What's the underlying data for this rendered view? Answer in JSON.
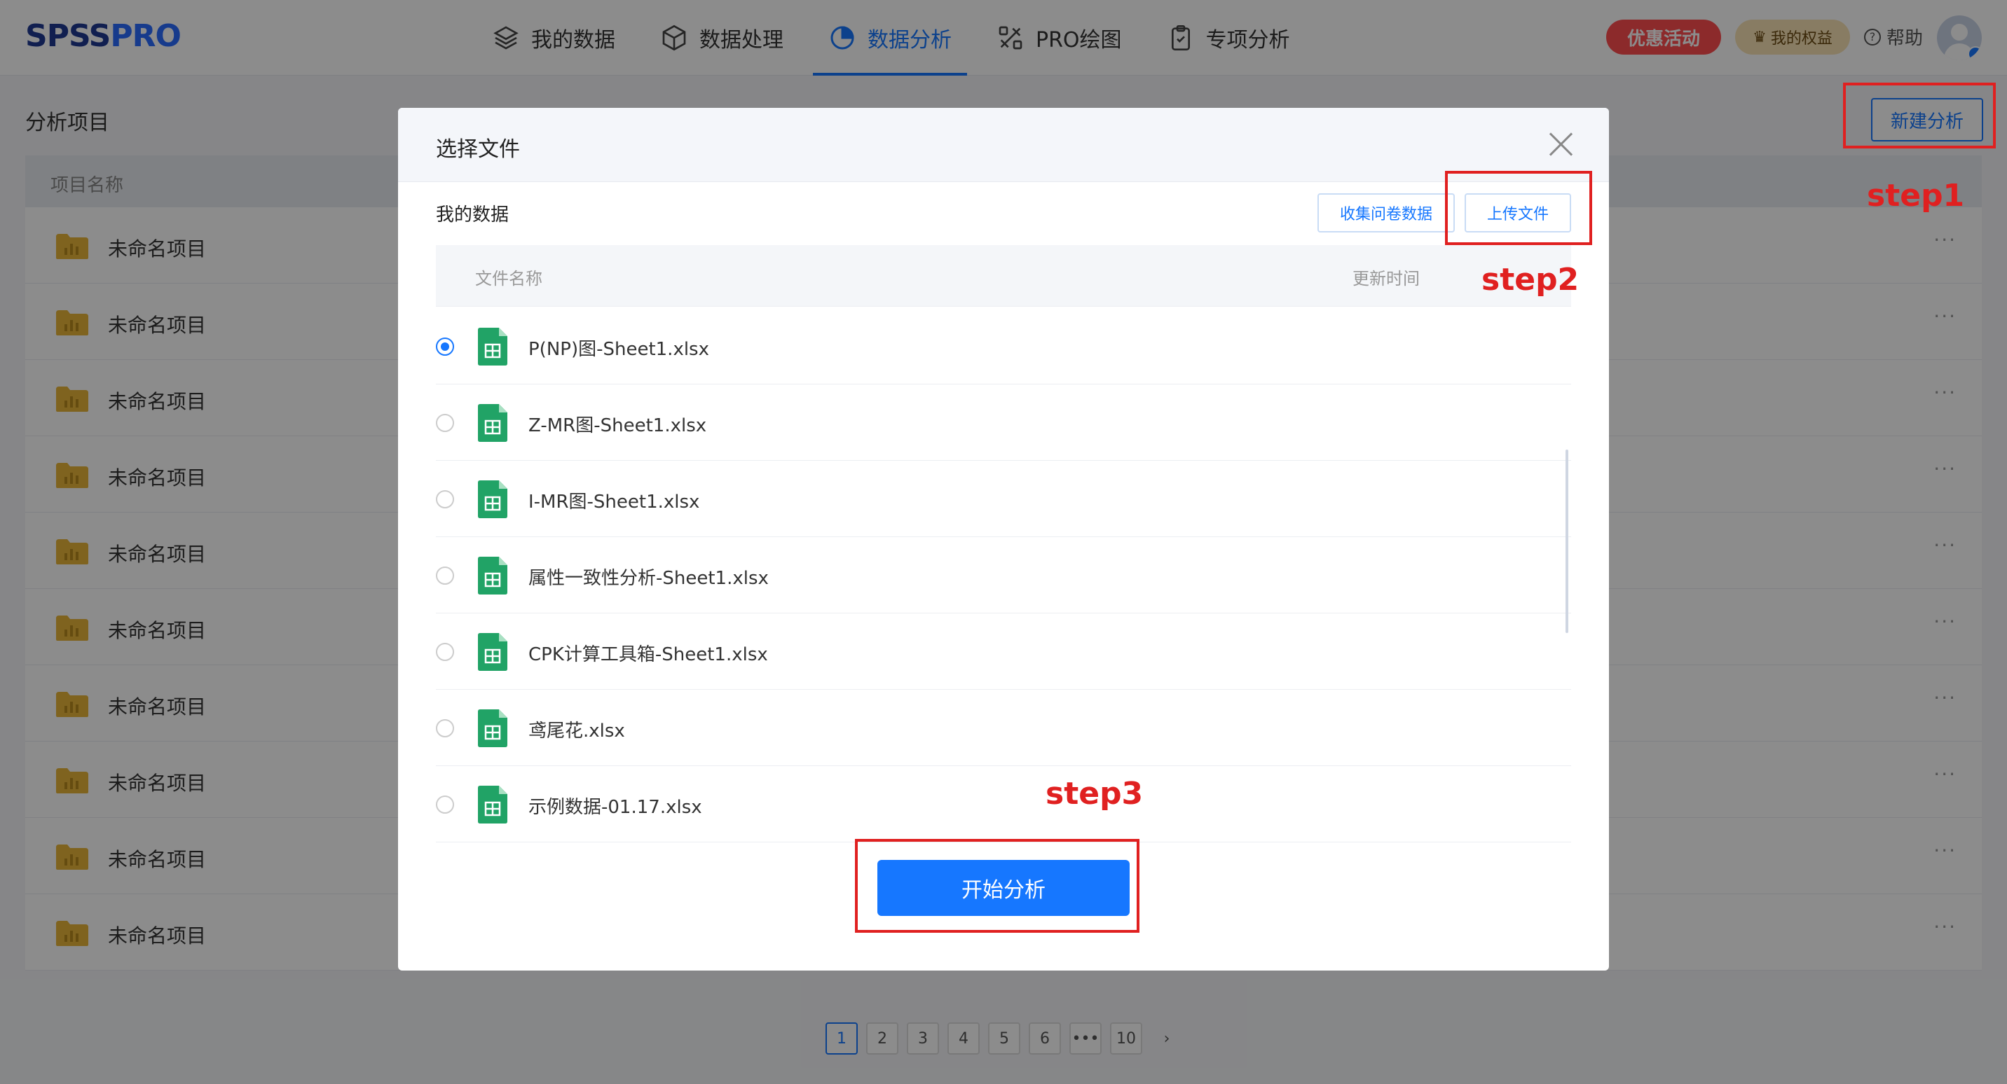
{
  "header": {
    "logo_main": "SPSS",
    "logo_accent": "PRO",
    "nav": [
      {
        "label": "我的数据",
        "icon": "layers-icon",
        "active": false
      },
      {
        "label": "数据处理",
        "icon": "cube-icon",
        "active": false
      },
      {
        "label": "数据分析",
        "icon": "pie-chart-icon",
        "active": true
      },
      {
        "label": "PRO绘图",
        "icon": "design-tools-icon",
        "active": false
      },
      {
        "label": "专项分析",
        "icon": "clipboard-icon",
        "active": false
      }
    ],
    "promo_label": "优惠活动",
    "rights_label": "我的权益",
    "help_label": "帮助"
  },
  "page": {
    "title": "分析项目",
    "new_button": "新建分析",
    "column_name": "项目名称",
    "projects": [
      "未命名项目",
      "未命名项目",
      "未命名项目",
      "未命名项目",
      "未命名项目",
      "未命名项目",
      "未命名项目",
      "未命名项目",
      "未命名项目",
      "未命名项目"
    ],
    "more_label": "···"
  },
  "pagination": {
    "pages": [
      "1",
      "2",
      "3",
      "4",
      "5",
      "6",
      "•••",
      "10"
    ],
    "current": "1",
    "next_label": "›"
  },
  "modal": {
    "title": "选择文件",
    "section_label": "我的数据",
    "collect_button": "收集问卷数据",
    "upload_button": "上传文件",
    "col_file_name": "文件名称",
    "col_updated": "更新时间",
    "files": [
      {
        "name": "P(NP)图-Sheet1.xlsx",
        "selected": true
      },
      {
        "name": "Z-MR图-Sheet1.xlsx",
        "selected": false
      },
      {
        "name": "I-MR图-Sheet1.xlsx",
        "selected": false
      },
      {
        "name": "属性一致性分析-Sheet1.xlsx",
        "selected": false
      },
      {
        "name": "CPK计算工具箱-Sheet1.xlsx",
        "selected": false
      },
      {
        "name": "鸢尾花.xlsx",
        "selected": false
      },
      {
        "name": "示例数据-01.17.xlsx",
        "selected": false
      }
    ],
    "start_button": "开始分析"
  },
  "annotations": {
    "step1": "step1",
    "step2": "step2",
    "step3": "step3"
  },
  "colors": {
    "primary": "#1677ff",
    "annotation": "#e02020",
    "promo": "#ff4d4f",
    "excel_green": "#21a366",
    "folder_gold": "#e8b53a"
  }
}
